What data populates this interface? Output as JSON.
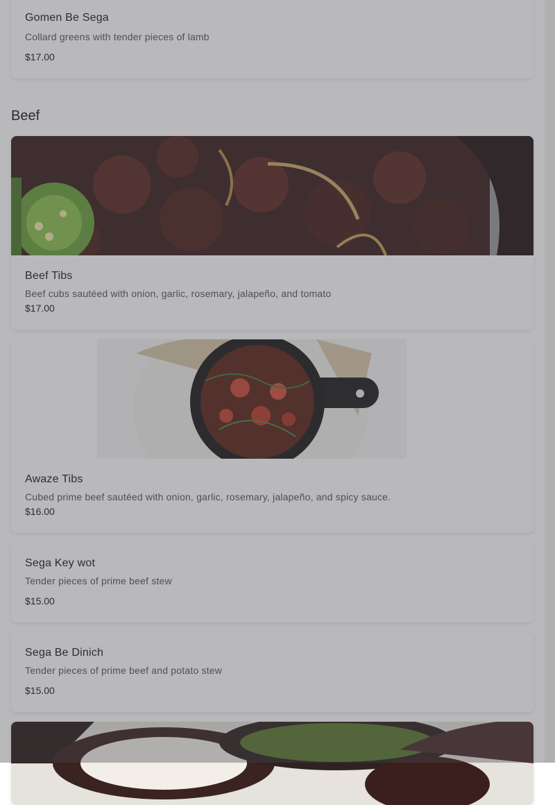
{
  "top_item": {
    "name": "Gomen Be Sega",
    "description": "Collard greens with tender pieces of lamb",
    "price": "$17.00"
  },
  "section": {
    "title": "Beef"
  },
  "items": [
    {
      "name": "Beef Tibs",
      "description": "Beef cubs sautéed with onion, garlic, rosemary, jalapeño, and tomato",
      "price": "$17.00"
    },
    {
      "name": "Awaze Tibs",
      "description": "Cubed prime beef sautéed with onion, garlic, rosemary, jalapeño, and spicy sauce.",
      "price": "$16.00"
    },
    {
      "name": "Sega Key wot",
      "description": "Tender pieces of prime beef stew",
      "price": "$15.00"
    },
    {
      "name": "Sega Be Dinich",
      "description": "Tender pieces of prime beef and potato stew",
      "price": "$15.00"
    }
  ],
  "colors": {
    "overlay": "#46464f",
    "card_bg": "#ffffff",
    "text_primary": "#1a1a1a",
    "text_secondary": "#555555"
  }
}
